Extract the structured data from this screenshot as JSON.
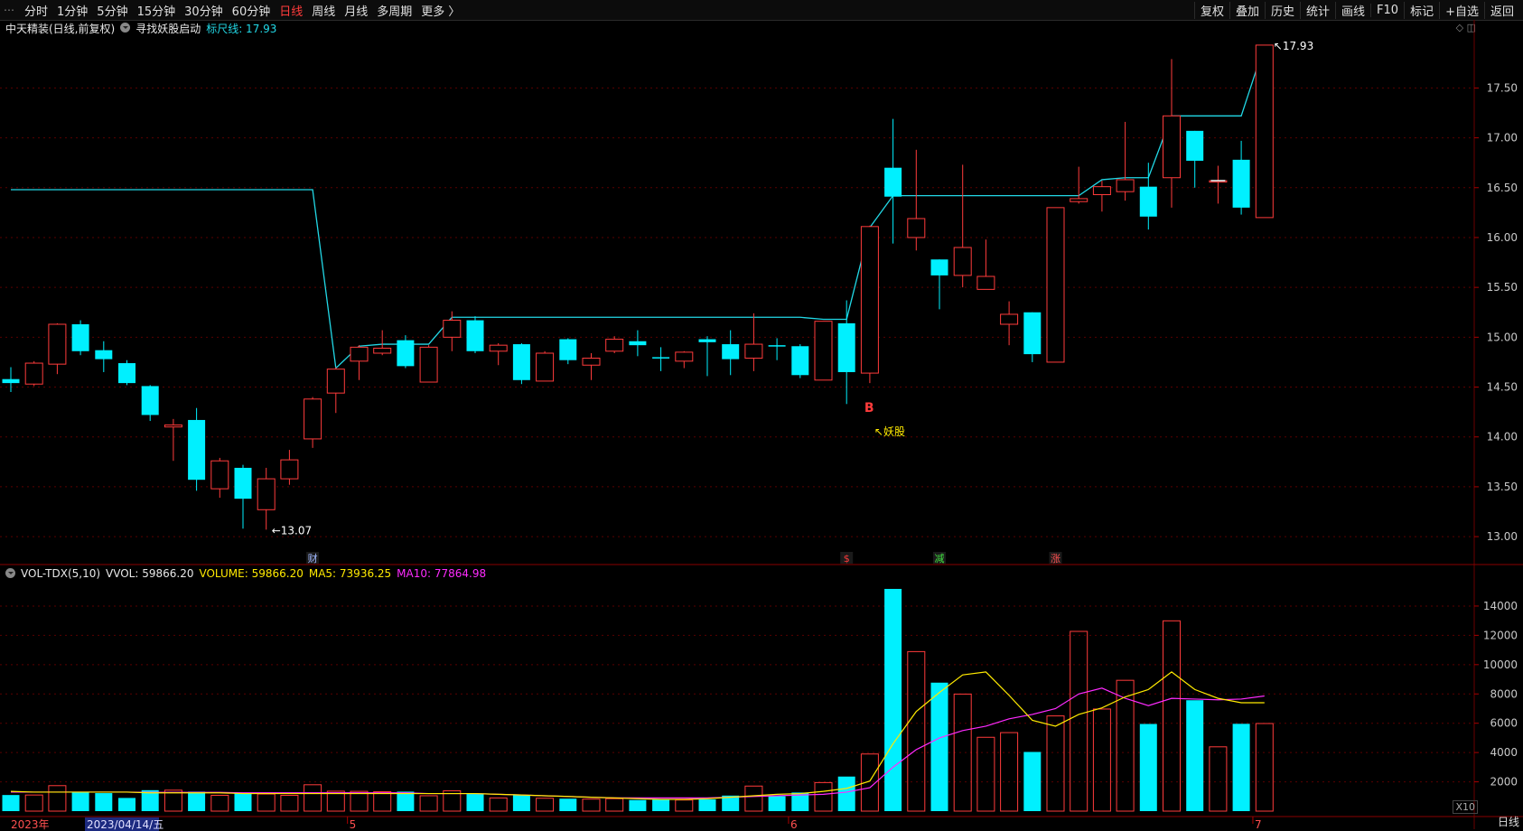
{
  "toolbar": {
    "left_items": [
      "分时",
      "1分钟",
      "5分钟",
      "15分钟",
      "30分钟",
      "60分钟",
      "日线",
      "周线",
      "月线",
      "多周期",
      "更多 〉"
    ],
    "active": "日线",
    "right_items": [
      "复权",
      "叠加",
      "历史",
      "统计",
      "画线",
      "F10",
      "标记",
      "+自选",
      "返回"
    ]
  },
  "info": {
    "stock": "中天精装(日线,前复权)",
    "indicator": "寻找妖股启动",
    "ruler": "标尺线: 17.93"
  },
  "volume_header": {
    "name": "VOL-TDX(5,10)",
    "vvol": "VVOL: 59866.20",
    "volume": "VOLUME: 59866.20",
    "ma5": "MA5: 73936.25",
    "ma10": "MA10: 77864.98"
  },
  "price_axis": [
    "17.50",
    "17.00",
    "16.50",
    "16.00",
    "15.50",
    "15.00",
    "14.50",
    "14.00",
    "13.50",
    "13.00"
  ],
  "volume_axis": [
    "14000",
    "12000",
    "10000",
    "8000",
    "6000",
    "4000",
    "2000"
  ],
  "volume_unit": "X10",
  "annotations": {
    "low": "←13.07",
    "high": "17.93",
    "buy": "B",
    "yaogu": "↖妖股",
    "events": [
      "财",
      "$",
      "减",
      "涨"
    ]
  },
  "dates": {
    "year": "2023年",
    "selected": "2023/04/14/五",
    "months": [
      "5",
      "6",
      "7"
    ]
  },
  "bottom_tab": "日线",
  "colors": {
    "up": "#ff3b3b",
    "down": "#00f0ff",
    "ruler": "#22d8e6",
    "ma5": "#ffea00",
    "ma10": "#ff2bff",
    "grid": "#5a0000"
  },
  "chart_data": {
    "type": "candlestick",
    "candles": [
      {
        "o": 14.58,
        "c": 14.54,
        "h": 14.7,
        "l": 14.45
      },
      {
        "o": 14.53,
        "c": 14.74,
        "h": 14.76,
        "l": 14.51
      },
      {
        "o": 14.73,
        "c": 15.13,
        "h": 15.14,
        "l": 14.63
      },
      {
        "o": 15.13,
        "c": 14.86,
        "h": 15.17,
        "l": 14.82
      },
      {
        "o": 14.87,
        "c": 14.78,
        "h": 14.96,
        "l": 14.65
      },
      {
        "o": 14.74,
        "c": 14.54,
        "h": 14.77,
        "l": 14.52
      },
      {
        "o": 14.51,
        "c": 14.22,
        "h": 14.52,
        "l": 14.16
      },
      {
        "o": 14.1,
        "c": 14.12,
        "h": 14.18,
        "l": 13.76
      },
      {
        "o": 14.17,
        "c": 13.57,
        "h": 14.29,
        "l": 13.46
      },
      {
        "o": 13.48,
        "c": 13.76,
        "h": 13.79,
        "l": 13.39
      },
      {
        "o": 13.69,
        "c": 13.38,
        "h": 13.72,
        "l": 13.08
      },
      {
        "o": 13.27,
        "c": 13.58,
        "h": 13.69,
        "l": 13.07
      },
      {
        "o": 13.58,
        "c": 13.77,
        "h": 13.87,
        "l": 13.52
      },
      {
        "o": 13.98,
        "c": 14.38,
        "h": 14.4,
        "l": 13.89
      },
      {
        "o": 14.44,
        "c": 14.68,
        "h": 14.7,
        "l": 14.24
      },
      {
        "o": 14.76,
        "c": 14.9,
        "h": 14.92,
        "l": 14.57
      },
      {
        "o": 14.84,
        "c": 14.89,
        "h": 15.07,
        "l": 14.82
      },
      {
        "o": 14.97,
        "c": 14.71,
        "h": 15.02,
        "l": 14.69
      },
      {
        "o": 14.55,
        "c": 14.9,
        "h": 14.92,
        "l": 14.55
      },
      {
        "o": 15.0,
        "c": 15.17,
        "h": 15.26,
        "l": 14.86
      },
      {
        "o": 15.17,
        "c": 14.86,
        "h": 15.21,
        "l": 14.84
      },
      {
        "o": 14.86,
        "c": 14.92,
        "h": 14.94,
        "l": 14.72
      },
      {
        "o": 14.93,
        "c": 14.57,
        "h": 14.94,
        "l": 14.53
      },
      {
        "o": 14.56,
        "c": 14.84,
        "h": 14.86,
        "l": 14.56
      },
      {
        "o": 14.98,
        "c": 14.77,
        "h": 14.99,
        "l": 14.73
      },
      {
        "o": 14.72,
        "c": 14.79,
        "h": 14.84,
        "l": 14.57
      },
      {
        "o": 14.86,
        "c": 14.98,
        "h": 15.01,
        "l": 14.84
      },
      {
        "o": 14.96,
        "c": 14.92,
        "h": 15.07,
        "l": 14.81
      },
      {
        "o": 14.8,
        "c": 14.79,
        "h": 14.9,
        "l": 14.66
      },
      {
        "o": 14.76,
        "c": 14.85,
        "h": 14.86,
        "l": 14.69
      },
      {
        "o": 14.98,
        "c": 14.95,
        "h": 15.01,
        "l": 14.61
      },
      {
        "o": 14.93,
        "c": 14.78,
        "h": 15.07,
        "l": 14.62
      },
      {
        "o": 14.79,
        "c": 14.93,
        "h": 15.24,
        "l": 14.66
      },
      {
        "o": 14.92,
        "c": 14.91,
        "h": 14.99,
        "l": 14.77
      },
      {
        "o": 14.91,
        "c": 14.62,
        "h": 14.93,
        "l": 14.59
      },
      {
        "o": 14.57,
        "c": 15.16,
        "h": 15.16,
        "l": 14.57
      },
      {
        "o": 15.14,
        "c": 14.65,
        "h": 15.37,
        "l": 14.33
      },
      {
        "o": 14.64,
        "c": 16.11,
        "h": 16.12,
        "l": 14.54
      },
      {
        "o": 16.7,
        "c": 16.41,
        "h": 17.19,
        "l": 15.94
      },
      {
        "o": 16.0,
        "c": 16.19,
        "h": 16.88,
        "l": 15.87
      },
      {
        "o": 15.78,
        "c": 15.62,
        "h": 15.78,
        "l": 15.28
      },
      {
        "o": 15.62,
        "c": 15.9,
        "h": 16.73,
        "l": 15.5
      },
      {
        "o": 15.48,
        "c": 15.61,
        "h": 15.98,
        "l": 15.48
      },
      {
        "o": 15.13,
        "c": 15.23,
        "h": 15.36,
        "l": 14.92
      },
      {
        "o": 15.25,
        "c": 14.83,
        "h": 15.25,
        "l": 14.75
      },
      {
        "o": 14.75,
        "c": 16.3,
        "h": 16.3,
        "l": 14.75
      },
      {
        "o": 16.36,
        "c": 16.39,
        "h": 16.71,
        "l": 16.34
      },
      {
        "o": 16.43,
        "c": 16.51,
        "h": 16.57,
        "l": 16.26
      },
      {
        "o": 16.46,
        "c": 16.58,
        "h": 17.16,
        "l": 16.37
      },
      {
        "o": 16.51,
        "c": 16.21,
        "h": 16.75,
        "l": 16.08
      },
      {
        "o": 16.6,
        "c": 17.22,
        "h": 17.79,
        "l": 16.3
      },
      {
        "o": 17.07,
        "c": 16.77,
        "h": 17.07,
        "l": 16.5
      },
      {
        "o": 16.57,
        "c": 16.57,
        "h": 16.72,
        "l": 16.34
      },
      {
        "o": 16.78,
        "c": 16.3,
        "h": 16.97,
        "l": 16.23
      },
      {
        "o": 16.2,
        "c": 17.93,
        "h": 17.93,
        "l": 16.2
      }
    ],
    "volume": [
      1100,
      1100,
      1740,
      1300,
      1230,
      900,
      1430,
      1430,
      1330,
      1080,
      1230,
      1170,
      1080,
      1800,
      1360,
      1350,
      1330,
      1330,
      1050,
      1390,
      1190,
      900,
      1080,
      880,
      850,
      820,
      850,
      760,
      790,
      760,
      800,
      1060,
      1710,
      1020,
      1270,
      1950,
      2360,
      3900,
      15170,
      10890,
      8770,
      7990,
      5040,
      5360,
      4040,
      6500,
      12270,
      6970,
      8930,
      5950,
      12990,
      7570,
      4390,
      5960,
      5980
    ],
    "ruler_line": [
      16.48,
      16.48,
      16.48,
      16.48,
      16.48,
      16.48,
      16.48,
      16.48,
      16.48,
      16.48,
      16.48,
      16.48,
      16.48,
      16.48,
      14.69,
      14.91,
      14.93,
      14.93,
      14.93,
      15.2,
      15.2,
      15.2,
      15.2,
      15.2,
      15.2,
      15.2,
      15.2,
      15.2,
      15.2,
      15.2,
      15.2,
      15.2,
      15.2,
      15.2,
      15.2,
      15.18,
      15.18,
      16.1,
      16.42,
      16.42,
      16.42,
      16.42,
      16.42,
      16.42,
      16.42,
      16.42,
      16.42,
      16.58,
      16.6,
      16.6,
      17.22,
      17.22,
      17.22,
      17.22,
      17.93
    ],
    "ma5": [
      1350,
      1300,
      1300,
      1300,
      1300,
      1300,
      1250,
      1250,
      1250,
      1250,
      1200,
      1200,
      1200,
      1200,
      1200,
      1200,
      1200,
      1200,
      1200,
      1200,
      1200,
      1150,
      1100,
      1050,
      1000,
      950,
      900,
      850,
      800,
      800,
      850,
      950,
      1050,
      1150,
      1200,
      1350,
      1550,
      2050,
      4600,
      6800,
      8100,
      9300,
      9500,
      7900,
      6200,
      5800,
      6600,
      7050,
      7800,
      8300,
      9500,
      8300,
      7700,
      7400,
      7400
    ],
    "ma10": [
      1300,
      1300,
      1300,
      1300,
      1300,
      1300,
      1280,
      1280,
      1280,
      1280,
      1250,
      1250,
      1250,
      1250,
      1250,
      1250,
      1250,
      1250,
      1200,
      1200,
      1200,
      1150,
      1100,
      1050,
      1000,
      950,
      900,
      900,
      900,
      900,
      900,
      950,
      1000,
      1050,
      1100,
      1150,
      1300,
      1600,
      3000,
      4200,
      5000,
      5500,
      5800,
      6300,
      6600,
      7000,
      8000,
      8400,
      7700,
      7200,
      7700,
      7650,
      7600,
      7650,
      7860
    ],
    "price_range": [
      12.72,
      18.02
    ],
    "volume_range": [
      0,
      15600
    ]
  }
}
